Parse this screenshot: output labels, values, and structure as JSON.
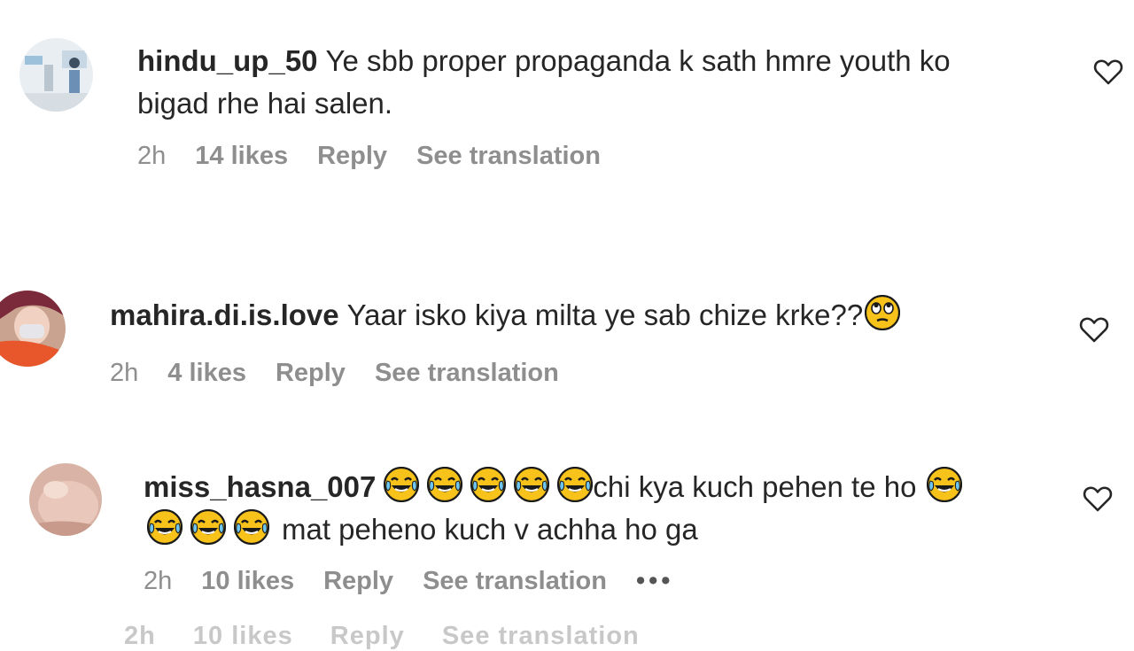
{
  "comments": [
    {
      "username": "hindu_up_50",
      "text_line1": "Ye sbb proper propaganda k sath hmre youth ko",
      "text_line2": "bigad rhe hai salen.",
      "time": "2h",
      "likes": "14 likes",
      "reply_label": "Reply",
      "translate_label": "See translation"
    },
    {
      "username": "mahira.di.is.love",
      "text_line1": "Yaar isko kiya milta ye sab chize krke??",
      "emoji_end": "face-with-rolling-eyes",
      "time": "2h",
      "likes": "4 likes",
      "reply_label": "Reply",
      "translate_label": "See translation"
    },
    {
      "username": "miss_hasna_007",
      "text_line1": "chi kya kuch pehen te ho",
      "text_line2": "mat peheno kuch v achha ho ga",
      "emoji_name": "face-with-tears-of-joy",
      "time": "2h",
      "likes": "10 likes",
      "reply_label": "Reply",
      "translate_label": "See translation",
      "more_label": "•••"
    }
  ],
  "cutoff_row": {
    "time": "2h",
    "likes": "10 likes",
    "reply_label": "Reply",
    "translate_label": "See translation"
  },
  "colors": {
    "text": "#262626",
    "meta": "#8e8e8e",
    "emoji_face": "#f7c21a"
  }
}
